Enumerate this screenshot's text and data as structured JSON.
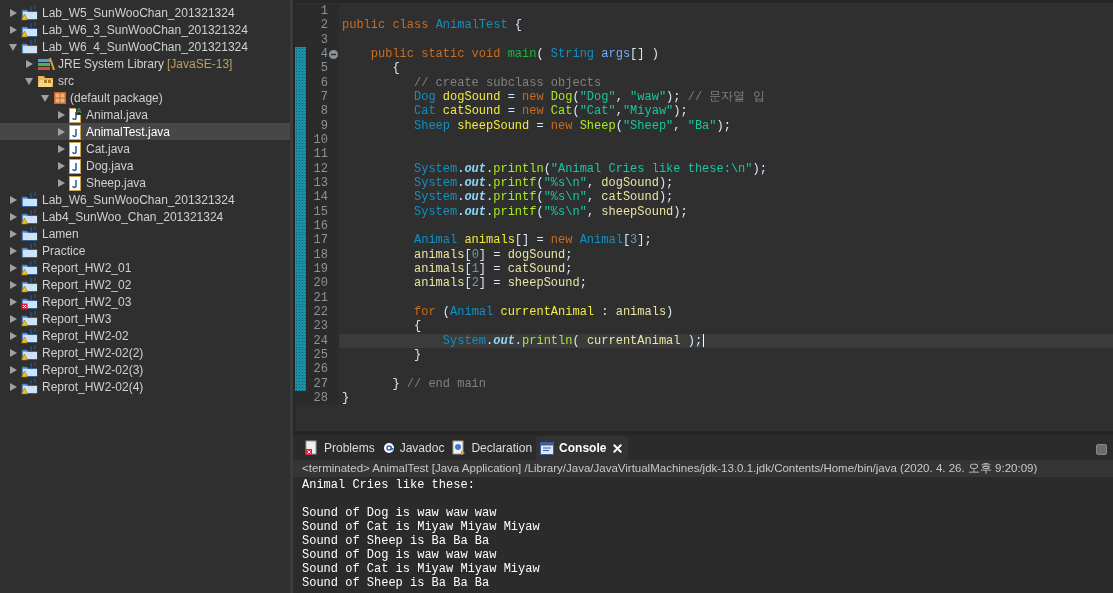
{
  "explorer": {
    "items": [
      {
        "label": "Lab_W5_SunWooChan_201321324",
        "kind": "project",
        "warning": true,
        "error": false,
        "expanded": false,
        "selected": false
      },
      {
        "label": "Lab_W6_3_SunWooChan_201321324",
        "kind": "project",
        "warning": true,
        "error": false,
        "expanded": false,
        "selected": false
      },
      {
        "label": "Lab_W6_4_SunWooChan_201321324",
        "kind": "project",
        "warning": false,
        "error": false,
        "expanded": true,
        "selected": false,
        "children": [
          {
            "label": "JRE System Library",
            "decoration": "[JavaSE-13]",
            "kind": "library",
            "expanded": false,
            "selected": false
          },
          {
            "label": "src",
            "kind": "source-folder",
            "expanded": true,
            "selected": false,
            "children": [
              {
                "label": "(default package)",
                "kind": "package",
                "expanded": true,
                "selected": false,
                "children": [
                  {
                    "label": "Animal.java",
                    "kind": "java-file",
                    "overlay": "A",
                    "expanded": false,
                    "selected": false
                  },
                  {
                    "label": "AnimalTest.java",
                    "kind": "java-file",
                    "expanded": false,
                    "selected": true
                  },
                  {
                    "label": "Cat.java",
                    "kind": "java-file",
                    "expanded": false,
                    "selected": false
                  },
                  {
                    "label": "Dog.java",
                    "kind": "java-file",
                    "expanded": false,
                    "selected": false
                  },
                  {
                    "label": "Sheep.java",
                    "kind": "java-file",
                    "expanded": false,
                    "selected": false
                  }
                ]
              }
            ]
          }
        ]
      },
      {
        "label": "Lab_W6_SunWooChan_201321324",
        "kind": "project",
        "warning": false,
        "error": false,
        "expanded": false,
        "selected": false
      },
      {
        "label": "Lab4_SunWoo_Chan_201321324",
        "kind": "project",
        "warning": true,
        "error": false,
        "expanded": false,
        "selected": false
      },
      {
        "label": "Lamen",
        "kind": "project",
        "warning": false,
        "error": false,
        "expanded": false,
        "selected": false
      },
      {
        "label": "Practice",
        "kind": "project",
        "warning": false,
        "error": false,
        "expanded": false,
        "selected": false
      },
      {
        "label": "Report_HW2_01",
        "kind": "project",
        "warning": true,
        "error": false,
        "expanded": false,
        "selected": false
      },
      {
        "label": "Report_HW2_02",
        "kind": "project",
        "warning": true,
        "error": false,
        "expanded": false,
        "selected": false
      },
      {
        "label": "Report_HW2_03",
        "kind": "project",
        "warning": false,
        "error": true,
        "expanded": false,
        "selected": false
      },
      {
        "label": "Report_HW3",
        "kind": "project",
        "warning": true,
        "error": false,
        "expanded": false,
        "selected": false
      },
      {
        "label": "Reprot_HW2-02",
        "kind": "project",
        "warning": true,
        "error": false,
        "expanded": false,
        "selected": false
      },
      {
        "label": "Reprot_HW2-02(2)",
        "kind": "project",
        "warning": true,
        "error": false,
        "expanded": false,
        "selected": false
      },
      {
        "label": "Reprot_HW2-02(3)",
        "kind": "project",
        "warning": true,
        "error": false,
        "expanded": false,
        "selected": false
      },
      {
        "label": "Reprot_HW2-02(4)",
        "kind": "project",
        "warning": true,
        "error": false,
        "expanded": false,
        "selected": false
      }
    ]
  },
  "editor": {
    "lines": [
      {
        "n": "1",
        "changed": false,
        "current": false,
        "foldable": false
      },
      {
        "n": "2",
        "changed": false,
        "current": false,
        "foldable": false,
        "tokens": [
          {
            "t": "public class ",
            "kind": "keyword"
          },
          {
            "t": "AnimalTest",
            "kind": "type"
          },
          {
            "t": " {",
            "kind": "plain"
          }
        ]
      },
      {
        "n": "3",
        "changed": false,
        "current": false,
        "foldable": false
      },
      {
        "n": "4",
        "changed": true,
        "current": false,
        "foldable": true,
        "tokens": [
          {
            "t": "    public static void ",
            "kind": "keyword"
          },
          {
            "t": "main",
            "kind": "method-decl"
          },
          {
            "t": "( ",
            "kind": "plain"
          },
          {
            "t": "String ",
            "kind": "type"
          },
          {
            "t": "args",
            "kind": "param"
          },
          {
            "t": "[] )",
            "kind": "plain"
          }
        ]
      },
      {
        "n": "5",
        "changed": true,
        "current": false,
        "foldable": false,
        "tokens": [
          {
            "t": "       {",
            "kind": "plain"
          }
        ]
      },
      {
        "n": "6",
        "changed": true,
        "current": false,
        "foldable": false,
        "tokens": [
          {
            "t": "          // create subclass objects",
            "kind": "comment"
          }
        ]
      },
      {
        "n": "7",
        "changed": true,
        "current": false,
        "foldable": false,
        "tokens": [
          {
            "t": "          Dog ",
            "kind": "type"
          },
          {
            "t": "dogSound",
            "kind": "local-decl"
          },
          {
            "t": " = ",
            "kind": "plain"
          },
          {
            "t": "new ",
            "kind": "keyword"
          },
          {
            "t": "Dog",
            "kind": "method"
          },
          {
            "t": "(",
            "kind": "plain"
          },
          {
            "t": "\"Dog\"",
            "kind": "string"
          },
          {
            "t": ", ",
            "kind": "plain"
          },
          {
            "t": "\"waw\"",
            "kind": "string"
          },
          {
            "t": "); ",
            "kind": "plain"
          },
          {
            "t": "// 문자열 입",
            "kind": "comment"
          }
        ]
      },
      {
        "n": "8",
        "changed": true,
        "current": false,
        "foldable": false,
        "tokens": [
          {
            "t": "          Cat ",
            "kind": "type"
          },
          {
            "t": "catSound",
            "kind": "local-decl"
          },
          {
            "t": " = ",
            "kind": "plain"
          },
          {
            "t": "new ",
            "kind": "keyword"
          },
          {
            "t": "Cat",
            "kind": "method"
          },
          {
            "t": "(",
            "kind": "plain"
          },
          {
            "t": "\"Cat\"",
            "kind": "string"
          },
          {
            "t": ",",
            "kind": "plain"
          },
          {
            "t": "\"Miyaw\"",
            "kind": "string"
          },
          {
            "t": ");",
            "kind": "plain"
          }
        ]
      },
      {
        "n": "9",
        "changed": true,
        "current": false,
        "foldable": false,
        "tokens": [
          {
            "t": "          Sheep ",
            "kind": "type"
          },
          {
            "t": "sheepSound",
            "kind": "local-decl"
          },
          {
            "t": " = ",
            "kind": "plain"
          },
          {
            "t": "new ",
            "kind": "keyword"
          },
          {
            "t": "Sheep",
            "kind": "method"
          },
          {
            "t": "(",
            "kind": "plain"
          },
          {
            "t": "\"Sheep\"",
            "kind": "string"
          },
          {
            "t": ", ",
            "kind": "plain"
          },
          {
            "t": "\"Ba\"",
            "kind": "string"
          },
          {
            "t": ");",
            "kind": "plain"
          }
        ]
      },
      {
        "n": "10",
        "changed": true,
        "current": false,
        "foldable": false
      },
      {
        "n": "11",
        "changed": true,
        "current": false,
        "foldable": false
      },
      {
        "n": "12",
        "changed": true,
        "current": false,
        "foldable": false,
        "tokens": [
          {
            "t": "          System",
            "kind": "type"
          },
          {
            "t": ".",
            "kind": "plain"
          },
          {
            "t": "out",
            "kind": "static-field"
          },
          {
            "t": ".",
            "kind": "plain"
          },
          {
            "t": "println",
            "kind": "method"
          },
          {
            "t": "(",
            "kind": "plain"
          },
          {
            "t": "\"Animal Cries like these:\\n\"",
            "kind": "string"
          },
          {
            "t": ");",
            "kind": "plain"
          }
        ]
      },
      {
        "n": "13",
        "changed": true,
        "current": false,
        "foldable": false,
        "tokens": [
          {
            "t": "          System",
            "kind": "type"
          },
          {
            "t": ".",
            "kind": "plain"
          },
          {
            "t": "out",
            "kind": "static-field"
          },
          {
            "t": ".",
            "kind": "plain"
          },
          {
            "t": "printf",
            "kind": "method"
          },
          {
            "t": "(",
            "kind": "plain"
          },
          {
            "t": "\"%s\\n\"",
            "kind": "string"
          },
          {
            "t": ", ",
            "kind": "plain"
          },
          {
            "t": "dogSound",
            "kind": "local"
          },
          {
            "t": ");",
            "kind": "plain"
          }
        ]
      },
      {
        "n": "14",
        "changed": true,
        "current": false,
        "foldable": false,
        "tokens": [
          {
            "t": "          System",
            "kind": "type"
          },
          {
            "t": ".",
            "kind": "plain"
          },
          {
            "t": "out",
            "kind": "static-field"
          },
          {
            "t": ".",
            "kind": "plain"
          },
          {
            "t": "printf",
            "kind": "method"
          },
          {
            "t": "(",
            "kind": "plain"
          },
          {
            "t": "\"%s\\n\"",
            "kind": "string"
          },
          {
            "t": ", ",
            "kind": "plain"
          },
          {
            "t": "catSound",
            "kind": "local"
          },
          {
            "t": ");",
            "kind": "plain"
          }
        ]
      },
      {
        "n": "15",
        "changed": true,
        "current": false,
        "foldable": false,
        "tokens": [
          {
            "t": "          System",
            "kind": "type"
          },
          {
            "t": ".",
            "kind": "plain"
          },
          {
            "t": "out",
            "kind": "static-field"
          },
          {
            "t": ".",
            "kind": "plain"
          },
          {
            "t": "printf",
            "kind": "method"
          },
          {
            "t": "(",
            "kind": "plain"
          },
          {
            "t": "\"%s\\n\"",
            "kind": "string"
          },
          {
            "t": ", ",
            "kind": "plain"
          },
          {
            "t": "sheepSound",
            "kind": "local"
          },
          {
            "t": ");",
            "kind": "plain"
          }
        ]
      },
      {
        "n": "16",
        "changed": true,
        "current": false,
        "foldable": false
      },
      {
        "n": "17",
        "changed": true,
        "current": false,
        "foldable": false,
        "tokens": [
          {
            "t": "          Animal ",
            "kind": "type"
          },
          {
            "t": "animals",
            "kind": "local-decl"
          },
          {
            "t": "[] = ",
            "kind": "plain"
          },
          {
            "t": "new ",
            "kind": "keyword"
          },
          {
            "t": "Animal",
            "kind": "type"
          },
          {
            "t": "[",
            "kind": "plain"
          },
          {
            "t": "3",
            "kind": "number"
          },
          {
            "t": "];",
            "kind": "plain"
          }
        ]
      },
      {
        "n": "18",
        "changed": true,
        "current": false,
        "foldable": false,
        "tokens": [
          {
            "t": "          animals",
            "kind": "local"
          },
          {
            "t": "[",
            "kind": "plain"
          },
          {
            "t": "0",
            "kind": "number"
          },
          {
            "t": "] = ",
            "kind": "plain"
          },
          {
            "t": "dogSound",
            "kind": "local"
          },
          {
            "t": ";",
            "kind": "plain"
          }
        ]
      },
      {
        "n": "19",
        "changed": true,
        "current": false,
        "foldable": false,
        "tokens": [
          {
            "t": "          animals",
            "kind": "local"
          },
          {
            "t": "[",
            "kind": "plain"
          },
          {
            "t": "1",
            "kind": "number"
          },
          {
            "t": "] = ",
            "kind": "plain"
          },
          {
            "t": "catSound",
            "kind": "local"
          },
          {
            "t": ";",
            "kind": "plain"
          }
        ]
      },
      {
        "n": "20",
        "changed": true,
        "current": false,
        "foldable": false,
        "tokens": [
          {
            "t": "          animals",
            "kind": "local"
          },
          {
            "t": "[",
            "kind": "plain"
          },
          {
            "t": "2",
            "kind": "number"
          },
          {
            "t": "] = ",
            "kind": "plain"
          },
          {
            "t": "sheepSound",
            "kind": "local"
          },
          {
            "t": ";",
            "kind": "plain"
          }
        ]
      },
      {
        "n": "21",
        "changed": true,
        "current": false,
        "foldable": false
      },
      {
        "n": "22",
        "changed": true,
        "current": false,
        "foldable": false,
        "tokens": [
          {
            "t": "          for ",
            "kind": "keyword"
          },
          {
            "t": "(",
            "kind": "plain"
          },
          {
            "t": "Animal ",
            "kind": "type"
          },
          {
            "t": "currentAnimal",
            "kind": "local-decl"
          },
          {
            "t": " : ",
            "kind": "plain"
          },
          {
            "t": "animals",
            "kind": "local"
          },
          {
            "t": ")",
            "kind": "plain"
          }
        ]
      },
      {
        "n": "23",
        "changed": true,
        "current": false,
        "foldable": false,
        "tokens": [
          {
            "t": "          {",
            "kind": "plain"
          }
        ]
      },
      {
        "n": "24",
        "changed": true,
        "current": true,
        "foldable": false,
        "tokens": [
          {
            "t": "              System",
            "kind": "type"
          },
          {
            "t": ".",
            "kind": "plain"
          },
          {
            "t": "out",
            "kind": "static-field"
          },
          {
            "t": ".",
            "kind": "plain"
          },
          {
            "t": "println",
            "kind": "method"
          },
          {
            "t": "( ",
            "kind": "plain"
          },
          {
            "t": "currentAnimal",
            "kind": "local"
          },
          {
            "t": " );",
            "kind": "plain"
          }
        ]
      },
      {
        "n": "25",
        "changed": true,
        "current": false,
        "foldable": false,
        "tokens": [
          {
            "t": "          }",
            "kind": "plain"
          }
        ]
      },
      {
        "n": "26",
        "changed": true,
        "current": false,
        "foldable": false
      },
      {
        "n": "27",
        "changed": true,
        "current": false,
        "foldable": false,
        "tokens": [
          {
            "t": "       } ",
            "kind": "plain"
          },
          {
            "t": "// end main",
            "kind": "comment"
          }
        ]
      },
      {
        "n": "28",
        "changed": false,
        "current": false,
        "foldable": false,
        "tokens": [
          {
            "t": "}",
            "kind": "plain"
          }
        ]
      }
    ]
  },
  "bottom_panel": {
    "tabs": [
      {
        "label": "Problems",
        "kind": "problems",
        "selected": false
      },
      {
        "label": "Javadoc",
        "kind": "javadoc",
        "selected": false
      },
      {
        "label": "Declaration",
        "kind": "declaration",
        "selected": false
      },
      {
        "label": "Console",
        "kind": "console",
        "selected": true
      }
    ],
    "console_header": "<terminated> AnimalTest [Java Application] /Library/Java/JavaVirtualMachines/jdk-13.0.1.jdk/Contents/Home/bin/java (2020. 4. 26. 오후 9:20:09)",
    "console_lines": [
      {
        "text": "Animal Cries like these:",
        "blank_after": true
      },
      {
        "text": "Sound of Dog is waw waw waw",
        "blank_after": false
      },
      {
        "text": "Sound of Cat is Miyaw Miyaw Miyaw",
        "blank_after": false
      },
      {
        "text": "Sound of Sheep is Ba Ba Ba",
        "blank_after": false
      },
      {
        "text": "Sound of Dog is waw waw waw",
        "blank_after": false
      },
      {
        "text": "Sound of Cat is Miyaw Miyaw Miyaw",
        "blank_after": false
      },
      {
        "text": "Sound of Sheep is Ba Ba Ba",
        "blank_after": false
      }
    ]
  }
}
